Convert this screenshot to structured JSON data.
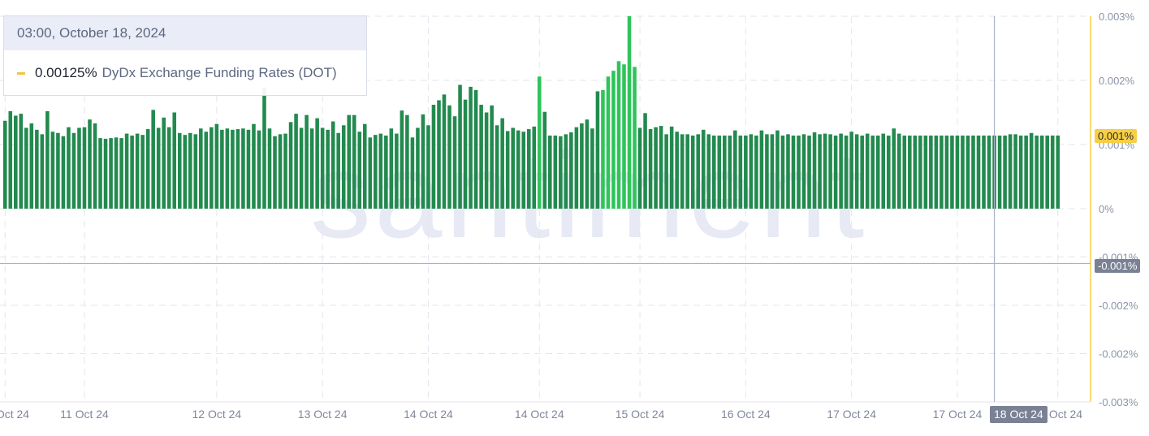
{
  "tooltip": {
    "datetime": "03:00, October 18, 2024",
    "value": "0.00125%",
    "series_label": "DyDx Exchange Funding Rates (DOT)"
  },
  "watermark": "santiment",
  "y_axis_badge_last": "0.001%",
  "y_axis_badge_cursor": "-0.001%",
  "x_axis_badge_cursor": "18 Oct 24",
  "colors": {
    "bar_default": "#228a4e",
    "bar_highlight": "#2fc45a",
    "grid": "#e3e6ee",
    "crosshair": "#a9b2c6",
    "right_axis": "#f6cf45"
  },
  "chart_data": {
    "type": "bar",
    "title": "",
    "xlabel": "",
    "ylabel": "",
    "ylim": [
      -0.003,
      0.003
    ],
    "y_tick_labels": [
      "0.003%",
      "0.002%",
      "0.001%",
      "0%",
      "-0.001%",
      "-0.002%",
      "-0.002%",
      "-0.003%"
    ],
    "y_tick_values": [
      0.003,
      0.002,
      0.001,
      0,
      -0.00075,
      -0.0015,
      -0.00225,
      -0.003
    ],
    "x_tick_labels": [
      "11 Oct 24",
      "11 Oct 24",
      "12 Oct 24",
      "13 Oct 24",
      "14 Oct 24",
      "14 Oct 24",
      "15 Oct 24",
      "16 Oct 24",
      "17 Oct 24",
      "17 Oct 24",
      "18 Oct 24"
    ],
    "x_tick_positions": [
      0,
      15,
      40,
      60,
      80,
      101,
      120,
      140,
      160,
      180,
      199
    ],
    "highlight_ranges": [
      [
        101,
        101
      ],
      [
        113,
        119
      ]
    ],
    "series": [
      {
        "values": [
          0.00137,
          0.00152,
          0.00145,
          0.00148,
          0.00126,
          0.00133,
          0.00123,
          0.00116,
          0.00152,
          0.0012,
          0.00118,
          0.00113,
          0.00127,
          0.00118,
          0.00126,
          0.00127,
          0.00139,
          0.00133,
          0.0011,
          0.00109,
          0.0011,
          0.00111,
          0.0011,
          0.00117,
          0.00114,
          0.00117,
          0.00115,
          0.00124,
          0.00154,
          0.00126,
          0.00142,
          0.00127,
          0.0015,
          0.00118,
          0.00115,
          0.00118,
          0.00116,
          0.00125,
          0.0012,
          0.00127,
          0.00132,
          0.00123,
          0.00125,
          0.00123,
          0.00124,
          0.00125,
          0.00123,
          0.00132,
          0.00122,
          0.00189,
          0.00125,
          0.00113,
          0.00116,
          0.00117,
          0.00135,
          0.00148,
          0.00126,
          0.00146,
          0.00125,
          0.00141,
          0.00126,
          0.00123,
          0.00136,
          0.00118,
          0.0013,
          0.00146,
          0.00146,
          0.0012,
          0.00132,
          0.00111,
          0.00115,
          0.00117,
          0.00114,
          0.00125,
          0.00117,
          0.00153,
          0.00146,
          0.00111,
          0.00126,
          0.00147,
          0.0013,
          0.00162,
          0.00169,
          0.00178,
          0.00161,
          0.00144,
          0.00193,
          0.0017,
          0.0019,
          0.00185,
          0.00162,
          0.0015,
          0.00161,
          0.0013,
          0.00141,
          0.00121,
          0.00126,
          0.00122,
          0.0012,
          0.00124,
          0.00128,
          0.00206,
          0.00151,
          0.00114,
          0.00114,
          0.00113,
          0.00116,
          0.00119,
          0.00127,
          0.00133,
          0.00139,
          0.00125,
          0.00183,
          0.00185,
          0.00206,
          0.00215,
          0.0023,
          0.00225,
          0.003,
          0.00221,
          0.00126,
          0.00149,
          0.00124,
          0.00127,
          0.00129,
          0.00116,
          0.00128,
          0.0012,
          0.00116,
          0.00116,
          0.00114,
          0.00116,
          0.00123,
          0.00116,
          0.00114,
          0.00114,
          0.00114,
          0.00114,
          0.00122,
          0.00114,
          0.00114,
          0.00116,
          0.00114,
          0.00122,
          0.00116,
          0.00116,
          0.00122,
          0.00114,
          0.00116,
          0.00114,
          0.00114,
          0.00116,
          0.00114,
          0.00119,
          0.00116,
          0.00117,
          0.00116,
          0.00114,
          0.00117,
          0.00114,
          0.0012,
          0.00116,
          0.00114,
          0.00117,
          0.00114,
          0.00114,
          0.00117,
          0.00114,
          0.00125,
          0.00117,
          0.00114,
          0.00114,
          0.00114,
          0.00114,
          0.00114,
          0.00114,
          0.00114,
          0.00114,
          0.00114,
          0.00114,
          0.00114,
          0.00114,
          0.00114,
          0.00114,
          0.00114,
          0.00114,
          0.00114,
          0.00114,
          0.00114,
          0.00114,
          0.00116,
          0.00116,
          0.00114,
          0.00114,
          0.00118,
          0.00114,
          0.00114,
          0.00114,
          0.00114,
          0.00114
        ]
      }
    ],
    "grid": true,
    "crosshair": {
      "x_index": 187,
      "y_value": -0.00085
    }
  }
}
